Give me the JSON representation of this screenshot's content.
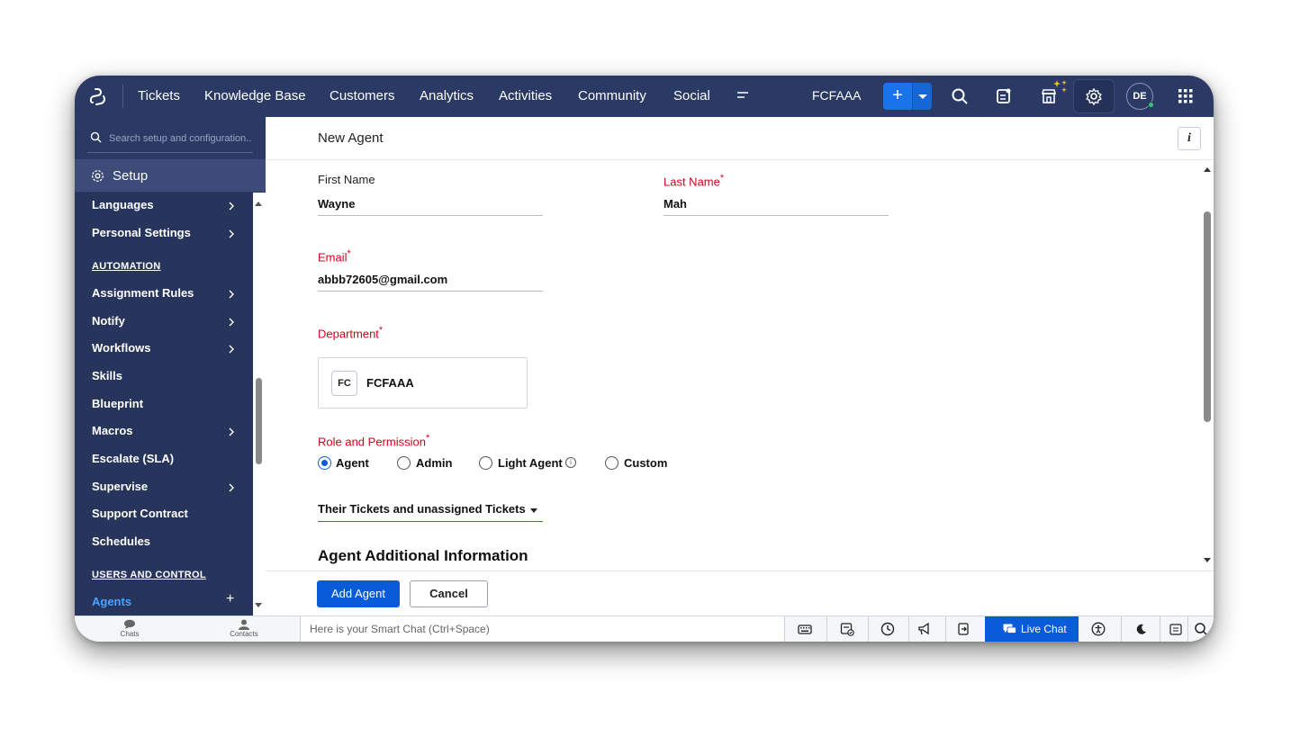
{
  "topnav": {
    "tabs": [
      "Tickets",
      "Knowledge Base",
      "Customers",
      "Analytics",
      "Activities",
      "Community",
      "Social"
    ],
    "org": "FCFAAA",
    "add_label": "+",
    "avatar_initials": "DE"
  },
  "sidebar": {
    "search_placeholder": "Search setup and configuration..",
    "setup_label": "Setup",
    "items": [
      {
        "label": "Languages",
        "chevron": true
      },
      {
        "label": "Personal Settings",
        "chevron": true
      }
    ],
    "automation_title": "AUTOMATION",
    "automation_items": [
      {
        "label": "Assignment Rules",
        "chevron": true
      },
      {
        "label": "Notify",
        "chevron": true
      },
      {
        "label": "Workflows",
        "chevron": true
      },
      {
        "label": "Skills",
        "chevron": false
      },
      {
        "label": "Blueprint",
        "chevron": false
      },
      {
        "label": "Macros",
        "chevron": true
      },
      {
        "label": "Escalate (SLA)",
        "chevron": false
      },
      {
        "label": "Supervise",
        "chevron": true
      },
      {
        "label": "Support Contract",
        "chevron": false
      },
      {
        "label": "Schedules",
        "chevron": false
      }
    ],
    "users_title": "USERS AND CONTROL",
    "active_item": "Agents",
    "active_plus": "+"
  },
  "form": {
    "title": "New Agent",
    "info_button": "i",
    "first_name_label": "First Name",
    "first_name_value": "Wayne",
    "last_name_label": "Last Name",
    "last_name_value": "Mah",
    "email_label": "Email",
    "email_value": "abbb72605@gmail.com",
    "department_label": "Department",
    "department_badge": "FC",
    "department_name": "FCFAAA",
    "role_label": "Role and Permission",
    "required_mark": "*",
    "roles": [
      "Agent",
      "Admin",
      "Light Agent",
      "Custom"
    ],
    "selected_role": "Agent",
    "ticket_access": "Their Tickets and unassigned Tickets",
    "section_title": "Agent Additional Information",
    "add_button": "Add Agent",
    "cancel_button": "Cancel"
  },
  "bottombar": {
    "chats_label": "Chats",
    "contacts_label": "Contacts",
    "smartchat_placeholder": "Here is your Smart Chat (Ctrl+Space)",
    "livechat_label": "Live Chat"
  },
  "colors": {
    "nav_bg": "#2b3a64",
    "accent": "#0a5bd8",
    "required": "#d0021b"
  }
}
